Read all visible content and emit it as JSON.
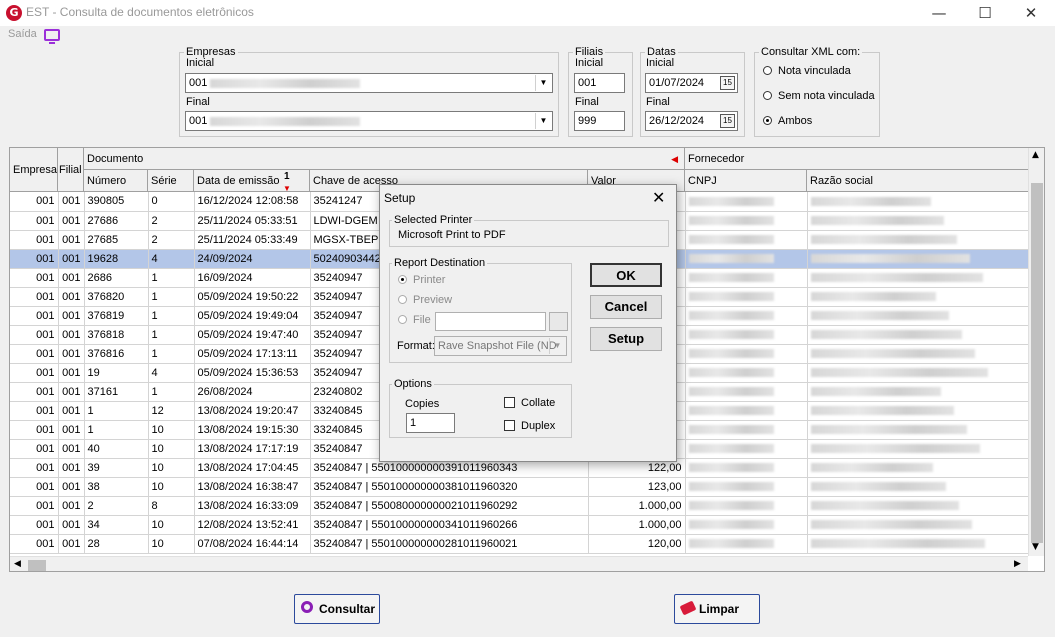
{
  "window": {
    "title": "EST - Consulta de documentos eletrônicos",
    "app_icon_letter": "G"
  },
  "menu": {
    "saida": "Saída"
  },
  "empresas": {
    "legend": "Empresas",
    "inicial_label": "Inicial",
    "inicial_value": "001",
    "final_label": "Final",
    "final_value": "001"
  },
  "filiais": {
    "legend": "Filiais",
    "inicial_label": "Inicial",
    "inicial_value": "001",
    "final_label": "Final",
    "final_value": "999"
  },
  "datas": {
    "legend": "Datas",
    "inicial_label": "Inicial",
    "inicial_value": "01/07/2024",
    "final_label": "Final",
    "final_value": "26/12/2024",
    "calendar_glyph": "15"
  },
  "consultar_xml": {
    "legend": "Consultar XML com:",
    "options": [
      "Nota vinculada",
      "Sem nota vinculada",
      "Ambos"
    ],
    "selected": "Ambos"
  },
  "grid": {
    "group_headers": {
      "empresa": "Empresa",
      "filial": "Filial",
      "documento": "Documento",
      "fornecedor": "Fornecedor"
    },
    "columns": {
      "numero": "Número",
      "serie": "Série",
      "data": "Data de emissão",
      "sort_index": "1",
      "chave": "Chave de acesso",
      "valor": "Valor",
      "cnpj": "CNPJ",
      "razao": "Razão social"
    },
    "rows": [
      {
        "empresa": "001",
        "filial": "001",
        "numero": "390805",
        "serie": "0",
        "data": "16/12/2024 12:08:58",
        "chave": "35241247",
        "valor": ""
      },
      {
        "empresa": "001",
        "filial": "001",
        "numero": "27686",
        "serie": "2",
        "data": "25/11/2024 05:33:51",
        "chave": "LDWI-DGEM",
        "valor": ""
      },
      {
        "empresa": "001",
        "filial": "001",
        "numero": "27685",
        "serie": "2",
        "data": "25/11/2024 05:33:49",
        "chave": "MGSX-TBEP",
        "valor": ""
      },
      {
        "empresa": "001",
        "filial": "001",
        "numero": "19628",
        "serie": "4",
        "data": "24/09/2024",
        "chave": "50240903442",
        "valor": ""
      },
      {
        "empresa": "001",
        "filial": "001",
        "numero": "2686",
        "serie": "1",
        "data": "16/09/2024",
        "chave": "35240947",
        "valor": ""
      },
      {
        "empresa": "001",
        "filial": "001",
        "numero": "376820",
        "serie": "1",
        "data": "05/09/2024 19:50:22",
        "chave": "35240947",
        "valor": ""
      },
      {
        "empresa": "001",
        "filial": "001",
        "numero": "376819",
        "serie": "1",
        "data": "05/09/2024 19:49:04",
        "chave": "35240947",
        "valor": ""
      },
      {
        "empresa": "001",
        "filial": "001",
        "numero": "376818",
        "serie": "1",
        "data": "05/09/2024 19:47:40",
        "chave": "35240947",
        "valor": ""
      },
      {
        "empresa": "001",
        "filial": "001",
        "numero": "376816",
        "serie": "1",
        "data": "05/09/2024 17:13:11",
        "chave": "35240947",
        "valor": ""
      },
      {
        "empresa": "001",
        "filial": "001",
        "numero": "19",
        "serie": "4",
        "data": "05/09/2024 15:36:53",
        "chave": "35240947",
        "valor": ""
      },
      {
        "empresa": "001",
        "filial": "001",
        "numero": "37161",
        "serie": "1",
        "data": "26/08/2024",
        "chave": "23240802",
        "valor": ""
      },
      {
        "empresa": "001",
        "filial": "001",
        "numero": "1",
        "serie": "12",
        "data": "13/08/2024 19:20:47",
        "chave": "33240845",
        "valor": ""
      },
      {
        "empresa": "001",
        "filial": "001",
        "numero": "1",
        "serie": "10",
        "data": "13/08/2024 19:15:30",
        "chave": "33240845",
        "valor": ""
      },
      {
        "empresa": "001",
        "filial": "001",
        "numero": "40",
        "serie": "10",
        "data": "13/08/2024 17:17:19",
        "chave": "35240847",
        "valor": ""
      },
      {
        "empresa": "001",
        "filial": "001",
        "numero": "39",
        "serie": "10",
        "data": "13/08/2024 17:04:45",
        "chave": "35240847 | 550100000000391011960343",
        "valor": "122,00"
      },
      {
        "empresa": "001",
        "filial": "001",
        "numero": "38",
        "serie": "10",
        "data": "13/08/2024 16:38:47",
        "chave": "35240847 | 550100000000381011960320",
        "valor": "123,00"
      },
      {
        "empresa": "001",
        "filial": "001",
        "numero": "2",
        "serie": "8",
        "data": "13/08/2024 16:33:09",
        "chave": "35240847 | 550080000000021011960292",
        "valor": "1.000,00"
      },
      {
        "empresa": "001",
        "filial": "001",
        "numero": "34",
        "serie": "10",
        "data": "12/08/2024 13:52:41",
        "chave": "35240847 | 550100000000341011960266",
        "valor": "1.000,00"
      },
      {
        "empresa": "001",
        "filial": "001",
        "numero": "28",
        "serie": "10",
        "data": "07/08/2024 16:44:14",
        "chave": "35240847 | 550100000000281011960021",
        "valor": "120,00"
      }
    ],
    "selected_row": 3
  },
  "dialog": {
    "title": "Setup",
    "selected_printer_legend": "Selected Printer",
    "printer_name": "Microsoft Print to PDF",
    "report_destination_legend": "Report Destination",
    "dest_options": [
      "Printer",
      "Preview",
      "File"
    ],
    "format_label": "Format:",
    "format_value": "Rave Snapshot File (ND",
    "options_legend": "Options",
    "copies_label": "Copies",
    "copies_value": "1",
    "collate_label": "Collate",
    "duplex_label": "Duplex",
    "ok": "OK",
    "cancel": "Cancel",
    "setup": "Setup"
  },
  "buttons": {
    "consultar": "Consultar",
    "limpar": "Limpar"
  },
  "colors": {
    "selection": "#b3c6e8",
    "accent_purple": "#9b30d9",
    "button_border": "#2c4a9c"
  }
}
